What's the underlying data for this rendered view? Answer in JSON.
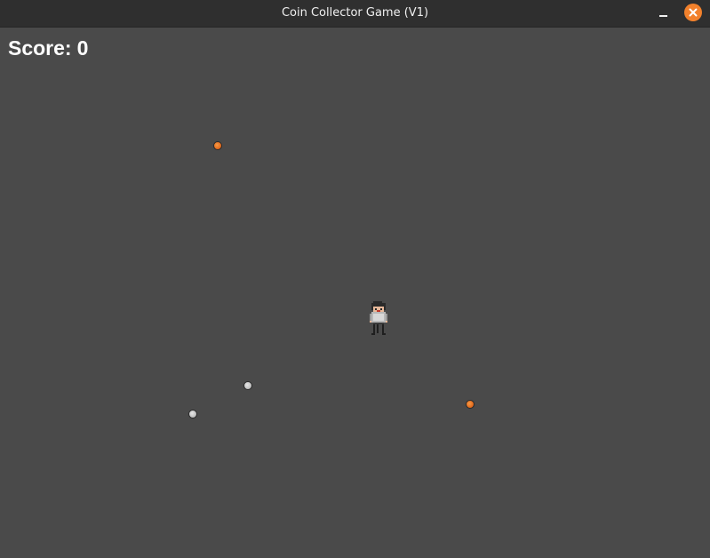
{
  "window": {
    "title": "Coin Collector Game (V1)",
    "close_color": "#f2812c",
    "controls": [
      "minimize-icon",
      "close-icon"
    ]
  },
  "hud": {
    "score_label": "Score:",
    "score_value": "0"
  },
  "colors": {
    "background": "#4a4a4a",
    "titlebar": "#2f2f2f",
    "gold_coin": "#e0661a",
    "silver_coin": "#c4c4c4"
  },
  "coins": [
    {
      "type": "gold"
    },
    {
      "type": "silver"
    },
    {
      "type": "silver"
    },
    {
      "type": "gold"
    }
  ],
  "player": {
    "sprite": "pixel-character"
  }
}
